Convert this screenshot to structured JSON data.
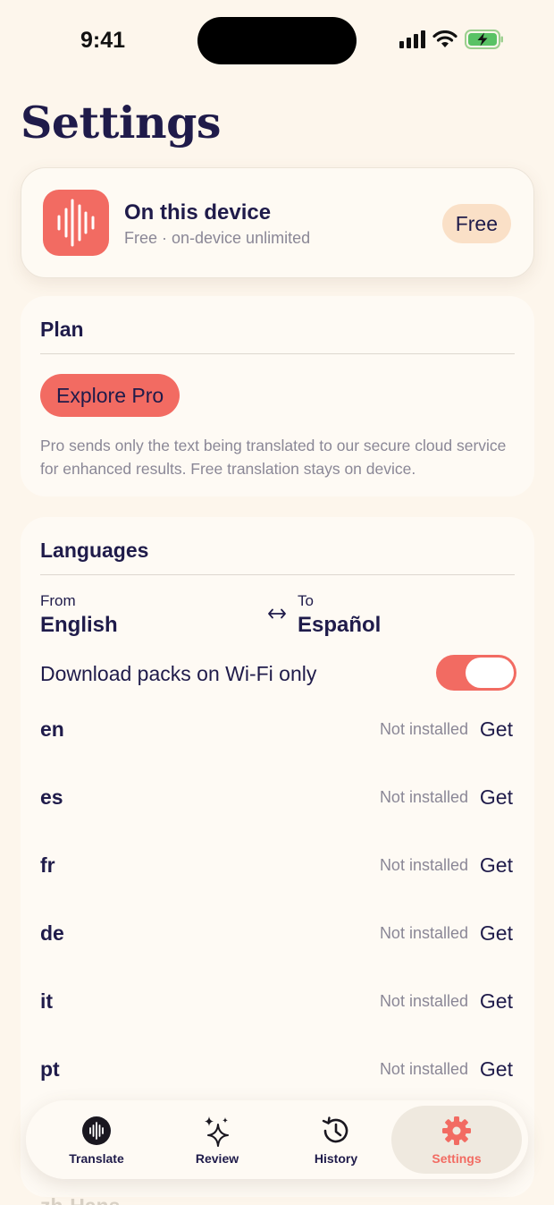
{
  "status_bar": {
    "time": "9:41"
  },
  "page": {
    "title": "Settings"
  },
  "device_card": {
    "name": "On this device",
    "subtitle": "Free · on-device unlimited",
    "badge": "Free",
    "accent_color": "#f26b62"
  },
  "plan": {
    "title": "Plan",
    "button_label": "Explore Pro",
    "note": "Pro sends only the text being translated to our secure cloud service for enhanced results. Free translation stays on device."
  },
  "languages": {
    "title": "Languages",
    "from_label": "From",
    "from_value": "English",
    "to_label": "To",
    "to_value": "Español",
    "wifi_label": "Download packs on Wi-Fi only",
    "wifi_only": true,
    "packs": [
      {
        "code": "en",
        "status": "Not installed",
        "action": "Get"
      },
      {
        "code": "es",
        "status": "Not installed",
        "action": "Get"
      },
      {
        "code": "fr",
        "status": "Not installed",
        "action": "Get"
      },
      {
        "code": "de",
        "status": "Not installed",
        "action": "Get"
      },
      {
        "code": "it",
        "status": "Not installed",
        "action": "Get"
      },
      {
        "code": "pt",
        "status": "Not installed",
        "action": "Get"
      }
    ],
    "partial_row": "zh-Hans"
  },
  "tabs": [
    {
      "label": "Translate",
      "icon": "waveform-icon"
    },
    {
      "label": "Review",
      "icon": "sparkles-icon"
    },
    {
      "label": "History",
      "icon": "clock-history-icon"
    },
    {
      "label": "Settings",
      "icon": "gear-icon",
      "active": true
    }
  ],
  "colors": {
    "background": "#fdf6ec",
    "accent": "#f26b62",
    "text": "#1f1b4a",
    "muted": "#8a8796",
    "badge": "#fae0c7"
  }
}
